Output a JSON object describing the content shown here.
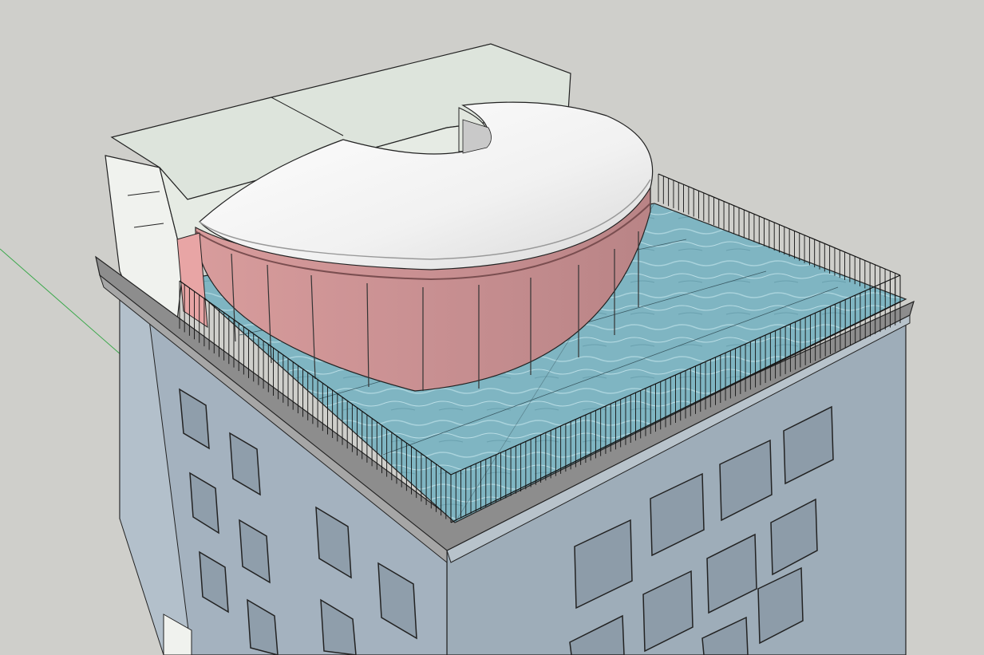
{
  "scene": {
    "type": "3d-model-viewport",
    "subject": "rooftop-pavilion-with-pool",
    "colors": {
      "background": "#cfcfcb",
      "facade_left": "#a4b2bf",
      "facade_right": "#9eadb9",
      "cornice": "#8d8d8d",
      "pool_water": "#7fb5c2",
      "glass": "#cf9a9c",
      "roof": "#eeeeee",
      "annex": "#dde4dc",
      "axis_green": "#3aa84a",
      "edge": "#222222"
    }
  }
}
